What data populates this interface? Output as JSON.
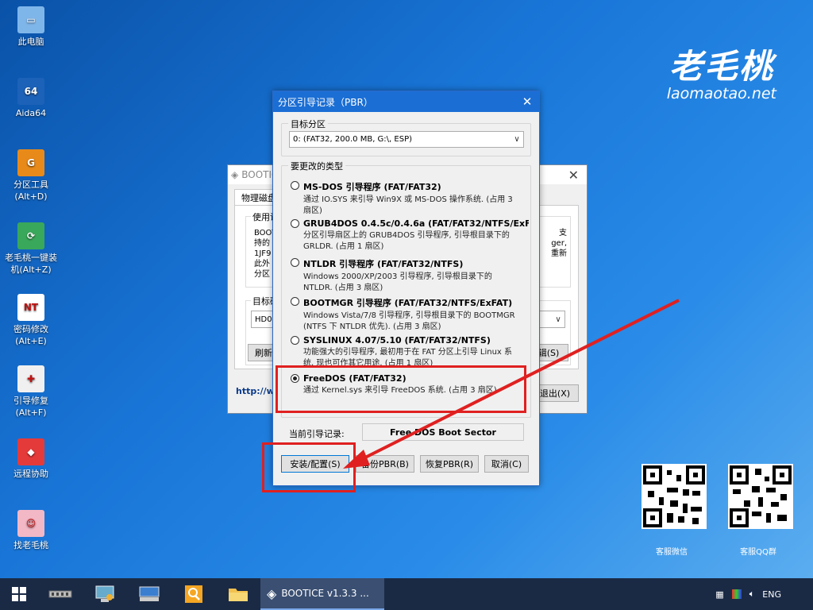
{
  "desktop": {
    "icons": [
      {
        "label": "此电脑",
        "glyph": "▭",
        "color": "#7fb6ea"
      },
      {
        "label": "Aida64",
        "glyph": "64",
        "color": "#1c62b8"
      },
      {
        "label": "分区工具\n(Alt+D)",
        "glyph": "G",
        "color": "#e88a1a"
      },
      {
        "label": "老毛桃一键装\n机(Alt+Z)",
        "glyph": "⟳",
        "color": "#3aa85a"
      },
      {
        "label": "密码修改\n(Alt+E)",
        "glyph": "NT",
        "color": "#ffffff"
      },
      {
        "label": "引导修复\n(Alt+F)",
        "glyph": "✚",
        "color": "#f0f0f0"
      },
      {
        "label": "远程协助",
        "glyph": "◆",
        "color": "#e53a3a"
      },
      {
        "label": "找老毛桃",
        "glyph": "☺",
        "color": "#f2b8c6"
      }
    ],
    "brand_logo": "老毛桃",
    "brand_url": "laomaotao.net",
    "qr_labels": [
      "客服微信",
      "客服QQ群"
    ]
  },
  "bg_window": {
    "title": "BOOTICE",
    "tab": "物理磁盘",
    "section1": "使用说",
    "lines": [
      "BOOT",
      "持的",
      "1JF9",
      "此外",
      "分区"
    ],
    "right_lines": [
      "支",
      "ger,",
      "",
      "重新"
    ],
    "section2": "目标磁",
    "disk_value": "HD0:",
    "refresh": "刷新",
    "right_btn": "辑(S)",
    "link": "http://w",
    "exit": "退出(X)"
  },
  "dialog": {
    "title": "分区引导记录（PBR）",
    "target_label": "目标分区",
    "target_value": "0: (FAT32, 200.0 MB, G:\\, ESP)",
    "type_label": "要更改的类型",
    "options": [
      {
        "title": "MS-DOS 引导程序 (FAT/FAT32)",
        "desc": "通过 IO.SYS 来引导 Win9X 或 MS-DOS 操作系统. (占用 3 扇区)",
        "selected": false
      },
      {
        "title": "GRUB4DOS 0.4.5c/0.4.6a (FAT/FAT32/NTFS/ExF",
        "desc": "分区引导扇区上的 GRUB4DOS 引导程序, 引导根目录下的 GRLDR. (占用 1 扇区)",
        "selected": false
      },
      {
        "title": "NTLDR 引导程序 (FAT/FAT32/NTFS)",
        "desc": "Windows 2000/XP/2003 引导程序, 引导根目录下的 NTLDR. (占用 3 扇区)",
        "selected": false
      },
      {
        "title": "BOOTMGR 引导程序 (FAT/FAT32/NTFS/ExFAT)",
        "desc": "Windows Vista/7/8 引导程序, 引导根目录下的 BOOTMGR (NTFS 下 NTLDR 优先). (占用 3 扇区)",
        "selected": false
      },
      {
        "title": "SYSLINUX 4.07/5.10 (FAT/FAT32/NTFS)",
        "desc": "功能强大的引导程序, 最初用于在 FAT 分区上引导 Linux 系统, 现也可作其它用途. (占用 1 扇区)",
        "selected": false
      },
      {
        "title": "FreeDOS (FAT/FAT32)",
        "desc": "通过 Kernel.sys 来引导 FreeDOS 系统. (占用 3 扇区)",
        "selected": true
      }
    ],
    "current_label": "当前引导记录:",
    "current_value": "Free DOS Boot Sector",
    "buttons": {
      "install": "安装/配置(S)",
      "backup": "备份PBR(B)",
      "restore": "恢复PBR(R)",
      "cancel": "取消(C)"
    }
  },
  "taskbar": {
    "active_task": "BOOTICE v1.3.3 ...",
    "lang": "ENG"
  }
}
